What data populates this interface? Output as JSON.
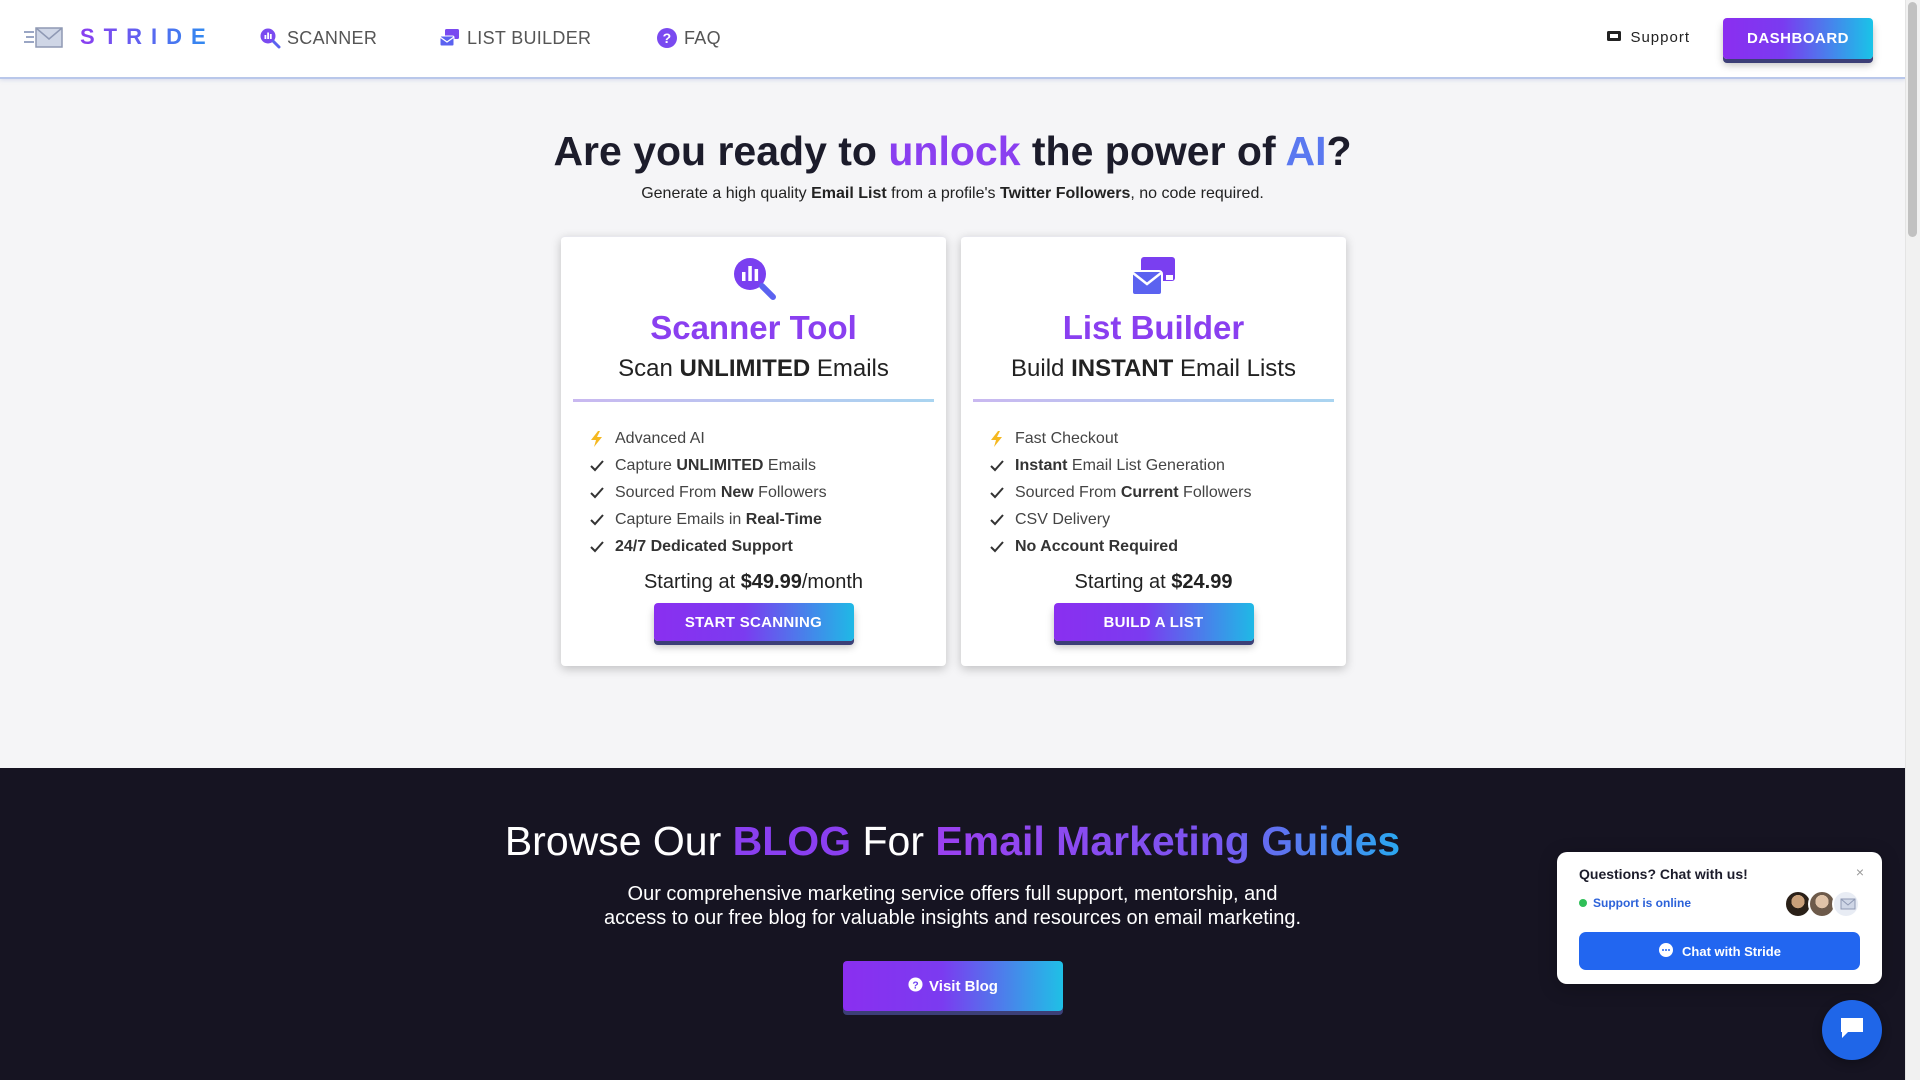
{
  "nav": {
    "brand": "STRIDE",
    "links": [
      {
        "label": "SCANNER",
        "icon": "scanner-magnifier-icon"
      },
      {
        "label": "LIST BUILDER",
        "icon": "list-builder-envelope-icon"
      },
      {
        "label": "FAQ",
        "icon": "question-circle-icon"
      }
    ],
    "support_label": "Support",
    "dashboard_label": "DASHBOARD"
  },
  "hero": {
    "title_pre": "Are you ready to ",
    "title_hl1": "unlock",
    "title_mid": " the power of ",
    "title_hl2": "AI",
    "title_end": "?",
    "sub_1": "Generate a high quality ",
    "sub_b1": "Email List",
    "sub_2": " from a profile's ",
    "sub_b2": "Twitter Followers",
    "sub_3": ", no code required."
  },
  "cards": [
    {
      "title": "Scanner Tool",
      "sub_pre": "Scan ",
      "sub_bold": "UNLIMITED",
      "sub_post": " Emails",
      "features": [
        {
          "pre": "Advanced AI",
          "bold": "",
          "post": "",
          "icon": "lightning-icon"
        },
        {
          "pre": "Capture ",
          "bold": "UNLIMITED",
          "post": " Emails",
          "icon": "check-icon"
        },
        {
          "pre": "Sourced From ",
          "bold": "New",
          "post": " Followers",
          "icon": "check-icon"
        },
        {
          "pre": "Capture Emails in ",
          "bold": "Real-Time",
          "post": "",
          "icon": "check-icon"
        },
        {
          "pre": "",
          "bold": "24/7 Dedicated Support",
          "post": "",
          "icon": "check-icon"
        }
      ],
      "price_pre": "Starting at ",
      "price": "$49.99",
      "price_post": "/month",
      "button": "START SCANNING"
    },
    {
      "title": "List Builder",
      "sub_pre": "Build ",
      "sub_bold": "INSTANT",
      "sub_post": " Email Lists",
      "features": [
        {
          "pre": "Fast Checkout",
          "bold": "",
          "post": "",
          "icon": "lightning-icon"
        },
        {
          "pre": "",
          "bold": "Instant",
          "post": " Email List Generation",
          "icon": "check-icon"
        },
        {
          "pre": "Sourced From ",
          "bold": "Current",
          "post": " Followers",
          "icon": "check-icon"
        },
        {
          "pre": "CSV Delivery",
          "bold": "",
          "post": "",
          "icon": "check-icon"
        },
        {
          "pre": "",
          "bold": "No Account Required",
          "post": "",
          "icon": "check-icon"
        }
      ],
      "price_pre": "Starting at ",
      "price": "$24.99",
      "price_post": "",
      "button": "BUILD A LIST"
    }
  ],
  "blog": {
    "title_pre": "Browse Our ",
    "title_hl1": "BLOG",
    "title_mid": " For ",
    "title_hl2": "Email Marketing Guides",
    "desc_line1": "Our comprehensive marketing service offers full support, mentorship, and",
    "desc_line2": "access to our free blog for valuable insights and resources on email marketing.",
    "button": "Visit Blog"
  },
  "chat": {
    "question": "Questions? Chat with us!",
    "status": "Support is online",
    "button": "Chat with Stride",
    "close": "×"
  },
  "colors": {
    "accent_purple": "#8a3ff0",
    "accent_blue": "#2266f0",
    "dark_section": "#161422"
  }
}
